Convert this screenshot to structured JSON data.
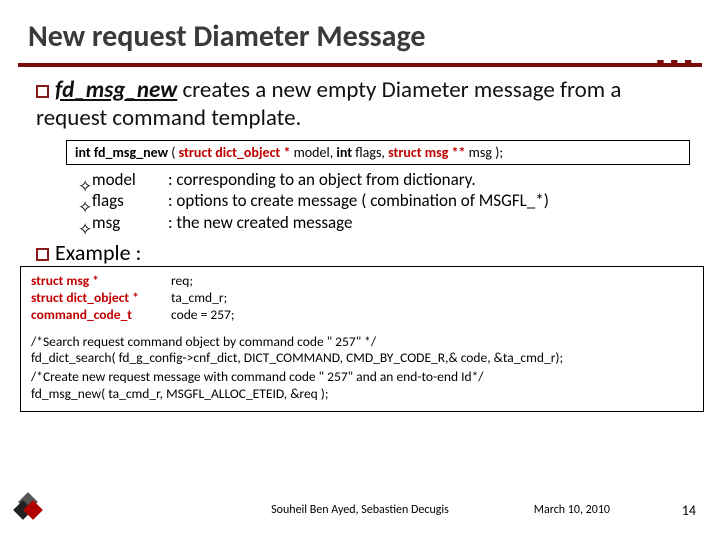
{
  "title": "New request Diameter Message",
  "lead": {
    "fn": "fd_msg_new",
    "rest": " creates a new empty Diameter message from a request command template."
  },
  "signature": {
    "ret": "int",
    "name": "fd_msg_new",
    "p1_kw": "struct",
    "p1_type": "dict_object *",
    "p1_name": "model",
    "p2_kw": "int",
    "p2_name": "flags",
    "p3_kw": "struct",
    "p3_type": "msg **",
    "p3_name": "msg"
  },
  "params": [
    {
      "name": "model",
      "desc": ": corresponding  to an object from dictionary."
    },
    {
      "name": "flags",
      "desc": ": options to create message ( combination of MSGFL_*)"
    },
    {
      "name": "msg",
      "desc": ": the new created message"
    }
  ],
  "example_label": "Example :",
  "code": {
    "d1t": "struct msg *",
    "d1v": "req;",
    "d2t": "struct dict_object *",
    "d2v": "ta_cmd_r;",
    "d3t": "command_code_t",
    "d3v": "code = 257;",
    "c1": "/*Search request command object by command code \" 257\" */",
    "l1": "fd_dict_search( fd_g_config->cnf_dict, DICT_COMMAND, CMD_BY_CODE_R,& code, &ta_cmd_r);",
    "c2": "/*Create new request message with command code \" 257\" and  an end-to-end Id*/",
    "l2": "fd_msg_new( ta_cmd_r, MSGFL_ALLOC_ETEID, &req );"
  },
  "footer": {
    "authors": "Souheil Ben Ayed, Sebastien Decugis",
    "date": "March 10, 2010",
    "page": "14"
  }
}
